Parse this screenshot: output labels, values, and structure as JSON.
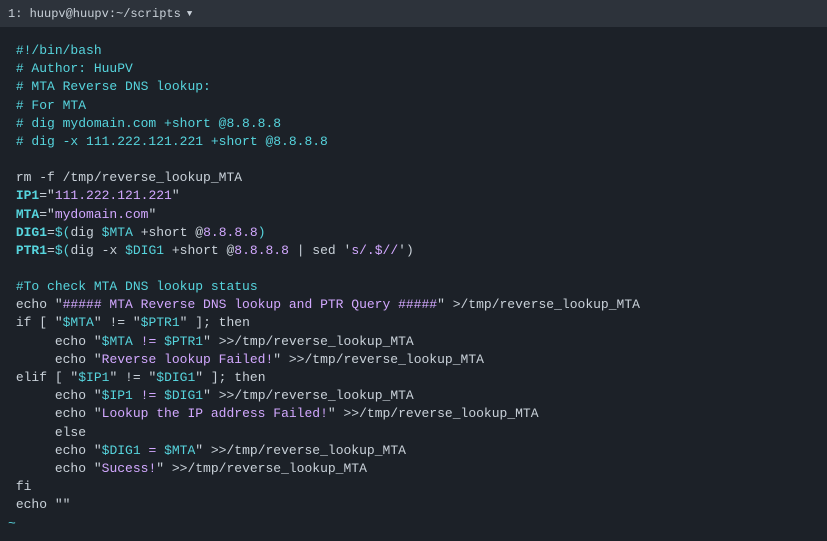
{
  "titlebar": {
    "label": "1: huupv@huupv:~/scripts",
    "dropdown_glyph": "▼"
  },
  "code": {
    "l01_shebang": "#!/bin/bash",
    "l02_author": "# Author: HuuPV",
    "l03_comment": "# MTA Reverse DNS lookup:",
    "l04_comment": "# For MTA",
    "l05_comment": "# dig mydomain.com +short @8.8.8.8",
    "l06_comment": "# dig -x 111.222.121.221 +short @8.8.8.8",
    "l07_rm": "rm -f /tmp/reverse_lookup_MTA",
    "l08_ip1_name": "IP1",
    "l08_ip1_val": "111.222.121.221",
    "l09_mta_name": "MTA",
    "l09_mta_val": "mydomain.com",
    "l10_dig1_name": "DIG1",
    "l10_dig1_cmd_pre": "dig ",
    "l10_dig1_var": "$MTA",
    "l10_dig1_cmd_mid": " +short @",
    "l10_dig1_dns": "8.8.8.8",
    "l11_ptr1_name": "PTR1",
    "l11_ptr1_cmd_pre": "dig -x ",
    "l11_ptr1_var": "$DIG1",
    "l11_ptr1_cmd_mid": " +short @",
    "l11_ptr1_dns": "8.8.8.8",
    "l11_ptr1_sed": " | sed '",
    "l11_ptr1_sedexpr": "s/.$//",
    "l11_ptr1_close": "')",
    "l12_comment": "#To check MTA DNS lookup status",
    "l13_echo": "echo \"",
    "l13_str": "##### MTA Reverse DNS lookup and PTR Query #####",
    "l13_tail": "\" >/tmp/reverse_lookup_MTA",
    "l14_if_pre": "if [ \"",
    "l14_var1": "$MTA",
    "l14_mid": "\" != \"",
    "l14_var2": "$PTR1",
    "l14_tail": "\" ]; then",
    "l15_echo": "     echo \"",
    "l15_v1": "$MTA",
    "l15_ne": " != ",
    "l15_v2": "$PTR1",
    "l15_tail": "\" >>/tmp/reverse_lookup_MTA",
    "l16_echo": "     echo \"",
    "l16_str": "Reverse lookup Failed!",
    "l16_tail": "\" >>/tmp/reverse_lookup_MTA",
    "l17_elif_pre": "elif [ \"",
    "l17_v1": "$IP1",
    "l17_mid": "\" != \"",
    "l17_v2": "$DIG1",
    "l17_tail": "\" ]; then",
    "l18_echo": "     echo \"",
    "l18_v1": "$IP1",
    "l18_ne": " != ",
    "l18_v2": "$DIG1",
    "l18_tail": "\" >>/tmp/reverse_lookup_MTA",
    "l19_echo": "     echo \"",
    "l19_str": "Lookup the IP address Failed!",
    "l19_tail": "\" >>/tmp/reverse_lookup_MTA",
    "l20_else": "     else",
    "l21_echo": "     echo \"",
    "l21_v1": "$DIG1",
    "l21_eq": " = ",
    "l21_v2": "$MTA",
    "l21_tail": "\" >>/tmp/reverse_lookup_MTA",
    "l22_echo": "     echo \"",
    "l22_str": "Sucess!",
    "l22_tail": "\" >>/tmp/reverse_lookup_MTA",
    "l23_fi": "fi",
    "l24_echo": "echo \"\"",
    "tilde": "~"
  }
}
